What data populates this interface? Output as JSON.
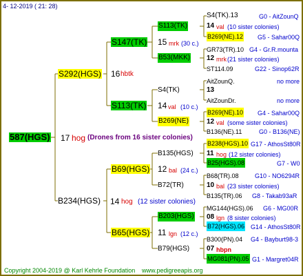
{
  "header": {
    "date": "4- 12-2019 ( 21: 28)"
  },
  "footer": {
    "copyright": "Copyright 2004-2019 @ Karl Kehrle Foundation",
    "website": "www.pedigreeapis.org"
  },
  "colors": {
    "green_box": "#00cc00",
    "yellow_box": "#ffff00",
    "cyan_box": "#00e5ff",
    "border": "#7d6e00",
    "blue_text": "#0000cc",
    "red_text": "#d70000"
  },
  "root": {
    "name": "587(HGS)",
    "gen": "17",
    "kind": "hog",
    "note": "(Drones from 16 sister colonies)"
  },
  "sire": {
    "name": "S292(HGS)",
    "gen": "16",
    "kind": "hbtk"
  },
  "dam": {
    "name": "B234(HGS)",
    "gen": "14",
    "kind": "hog",
    "note": "(12 sister colonies)"
  },
  "s_s": {
    "name": "S147(TK)",
    "gen": "15",
    "kind": "mrk",
    "note": "(30 c.)"
  },
  "s_d": {
    "name": "S113(TK)",
    "gen": "14",
    "kind": "val",
    "note": "(10 c.)"
  },
  "d_s": {
    "name": "B69(HGS)",
    "gen": "12",
    "kind": "bal",
    "note": "(24 c.)"
  },
  "d_d": {
    "name": "B65(HGS)",
    "gen": "11",
    "kind": "lgn",
    "note": "(12 c.)"
  },
  "ss_s": {
    "name": "S113(TK)",
    "gen": "14",
    "kind": "val",
    "note": "(10 sister colonies)",
    "a": "S4(TK).13",
    "a_info": "G0 - AitZounQ",
    "b": "B269(NE).12",
    "b_info": "G5 - Sahar00Q"
  },
  "ss_d": {
    "name": "B53(MKK)",
    "gen": "12",
    "kind": "mrk",
    "note": "(21 sister colonies)",
    "a": "GR73(TR).10",
    "a_info": "G4 - Gr.R.mounta",
    "b": "ST114.09",
    "b_info": "G22 - Sinop62R"
  },
  "sd_s": {
    "name": "S4(TK)",
    "gen": "13",
    "a": "AitZounQ.",
    "a_info": "no more",
    "b": "AitZounDr.",
    "b_info": "no more"
  },
  "sd_d": {
    "name": "B269(NE)",
    "gen": "12",
    "kind": "val",
    "note": "(some sister colonies)",
    "a": "B269(NE).10",
    "a_info": "G4 - Sahar00Q",
    "b": "B136(NE).11",
    "b_info": "G0 - B136(NE)"
  },
  "ds_s": {
    "name": "B135(HGS)",
    "gen": "11",
    "kind": "hog",
    "note": "(12 sister colonies)",
    "a": "B238(HGS).10",
    "a_info": "G17 - AthosSt80R",
    "b": "B25(HGS).08",
    "b_info": "G7 - W0"
  },
  "ds_d": {
    "name": "B72(TR)",
    "gen": "10",
    "kind": "bal",
    "note": "(23 sister colonies)",
    "a": "B68(TR).08",
    "a_info": "G10 - NO6294R",
    "b": "B135(TR).06",
    "b_info": "G8 - Takab93aR"
  },
  "dd_s": {
    "name": "B203(HGS)",
    "gen": "08",
    "kind": "lgn",
    "note": "(8 sister colonies)",
    "a": "MG144(HGS).06",
    "a_info": "G6 - MG00R",
    "b": "B72(HGS).06",
    "b_info": "G14 - AthosSt80R"
  },
  "dd_d": {
    "name": "B79(HGS)",
    "gen": "07",
    "kind": "hbpn",
    "a": "B300(PN).04",
    "a_info": "G4 - Bayburt98-3",
    "b": "MG081(PN).05",
    "b_info": "G1 - Margret04R"
  }
}
